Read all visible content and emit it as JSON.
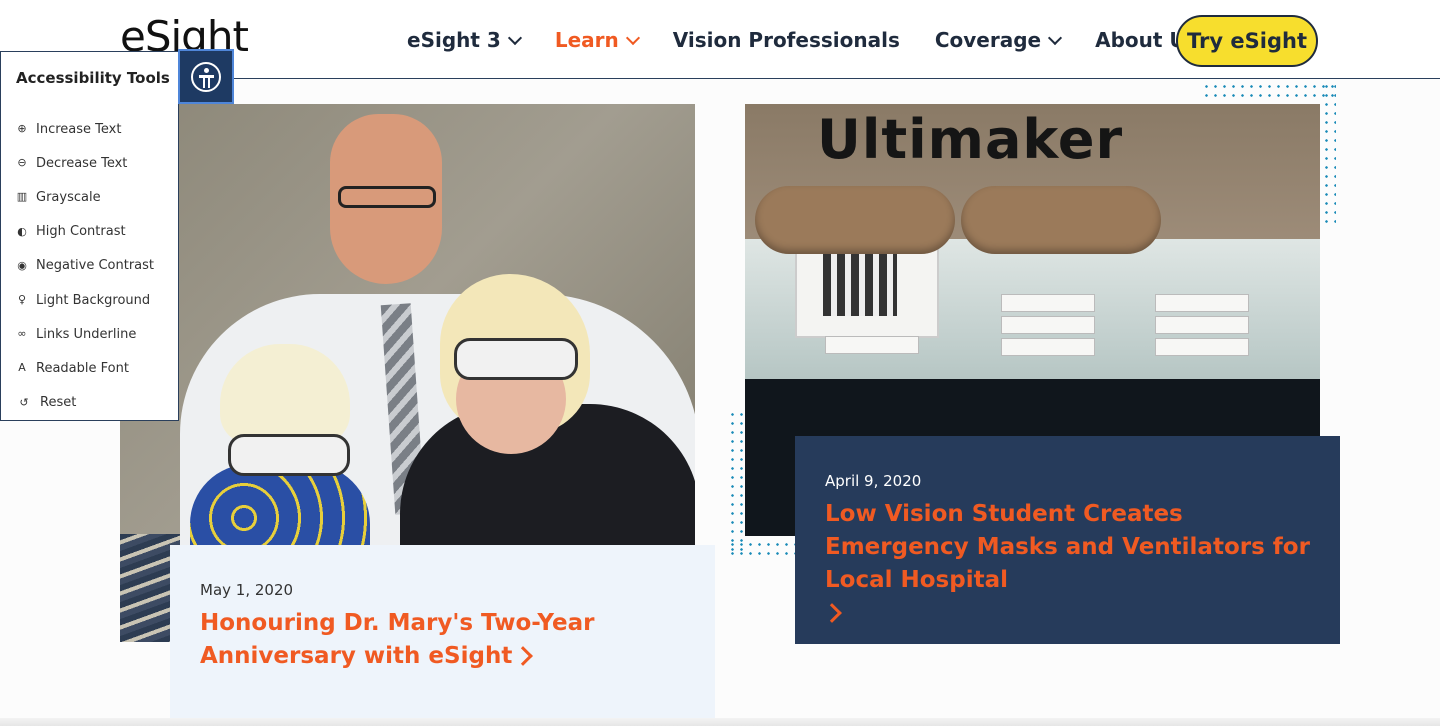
{
  "header": {
    "logo": "eSight",
    "nav": [
      {
        "label": "eSight 3",
        "dropdown": true
      },
      {
        "label": "Learn",
        "dropdown": true,
        "active": true
      },
      {
        "label": "Vision Professionals",
        "dropdown": false
      },
      {
        "label": "Coverage",
        "dropdown": true
      },
      {
        "label": "About Us",
        "dropdown": true
      }
    ],
    "cta_label": "Try eSight"
  },
  "accessibility": {
    "title": "Accessibility Tools",
    "items": [
      {
        "label": "Increase Text",
        "icon": "zoom-in-icon",
        "glyph": "⊕"
      },
      {
        "label": "Decrease Text",
        "icon": "zoom-out-icon",
        "glyph": "⊖"
      },
      {
        "label": "Grayscale",
        "icon": "barcode-icon",
        "glyph": "▥"
      },
      {
        "label": "High Contrast",
        "icon": "contrast-icon",
        "glyph": "◐"
      },
      {
        "label": "Negative Contrast",
        "icon": "eye-icon",
        "glyph": "◉"
      },
      {
        "label": "Light Background",
        "icon": "lightbulb-icon",
        "glyph": "♀"
      },
      {
        "label": "Links Underline",
        "icon": "link-icon",
        "glyph": "∞"
      },
      {
        "label": "Readable Font",
        "icon": "font-icon",
        "glyph": "A"
      },
      {
        "label": "Reset",
        "icon": "reset-icon",
        "glyph": "↺"
      }
    ]
  },
  "posts": [
    {
      "date": "May 1, 2020",
      "title": "Honouring Dr. Mary's Two-Year Anniversary with eSight"
    },
    {
      "date": "April 9, 2020",
      "title": "Low Vision Student Creates Emergency Masks and Ventilators for Local Hospital"
    }
  ],
  "photo2_brand": "Ultimaker",
  "colors": {
    "accent": "#f05a22",
    "navy": "#263b5b",
    "cta": "#f7de2d"
  }
}
